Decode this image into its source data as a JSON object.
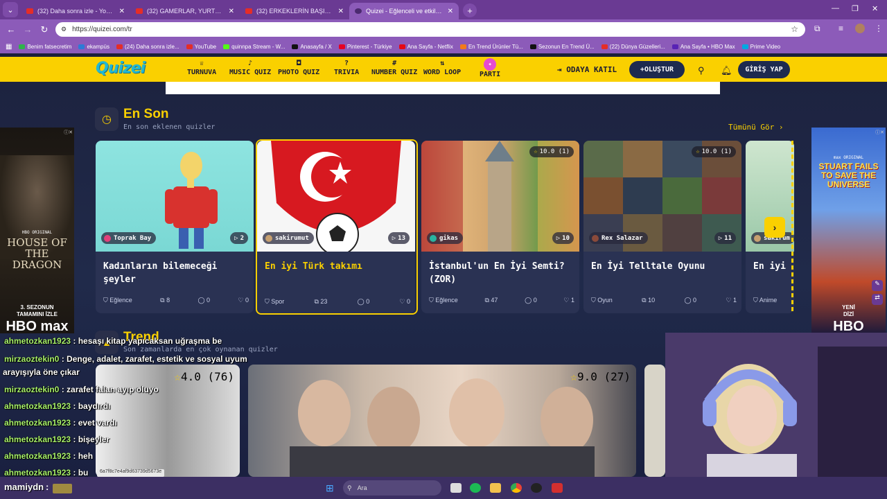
{
  "browser": {
    "tabs": [
      {
        "title": "(32) Daha sonra izle - YouTube",
        "icon": "youtube-icon"
      },
      {
        "title": "(32) GAMERLAR, YURTDIŞINDA",
        "icon": "youtube-icon"
      },
      {
        "title": "(32) ERKEKLERİN BAŞINI DÖNDÜ",
        "icon": "youtube-icon"
      },
      {
        "title": "Quizei - Eğlenceli ve etkileşimli",
        "icon": "quizei-icon"
      }
    ],
    "url": "https://quizei.com/tr",
    "bookmarks": [
      {
        "label": "Benim fatsecretim",
        "color": "#2fb34a"
      },
      {
        "label": "ekampüs",
        "color": "#2d7bd6"
      },
      {
        "label": "(24) Daha sonra izle...",
        "color": "#e52d27"
      },
      {
        "label": "YouTube",
        "color": "#e52d27"
      },
      {
        "label": "quinnpa Stream - W...",
        "color": "#53fc18"
      },
      {
        "label": "Anasayfa / X",
        "color": "#111111"
      },
      {
        "label": "Pinterest - Türkiye",
        "color": "#e60023"
      },
      {
        "label": "Ana Sayfa - Netflix",
        "color": "#e50914"
      },
      {
        "label": "En Trend Ürünler Tü...",
        "color": "#f27a1a"
      },
      {
        "label": "Sezonun En Trend Ü...",
        "color": "#111111"
      },
      {
        "label": "(22) Dünya Güzelleri...",
        "color": "#e52d27"
      },
      {
        "label": "Ana Sayfa • HBO Max",
        "color": "#5822b4"
      },
      {
        "label": "Prime Video",
        "color": "#00a8e1"
      }
    ]
  },
  "site": {
    "logo": "Quizei",
    "nav": [
      {
        "label": "TURNUVA",
        "icon": "trophy-icon"
      },
      {
        "label": "MUSIC QUIZ",
        "icon": "music-icon"
      },
      {
        "label": "PHOTO QUIZ",
        "icon": "camera-icon"
      },
      {
        "label": "TRIVIA",
        "icon": "question-icon"
      },
      {
        "label": "NUMBER QUIZ",
        "icon": "hash-icon"
      },
      {
        "label": "WORD LOOP",
        "icon": "sort-icon"
      },
      {
        "label": "PARTI",
        "icon": "party-icon"
      }
    ],
    "join_room": "ODAYA KATIL",
    "create": "OLUŞTUR",
    "login": "GİRİŞ YAP"
  },
  "latest": {
    "title": "En Son",
    "subtitle": "En son eklenen quizler",
    "see_all": "Tümünü Gör",
    "cards": [
      {
        "title": "Kadınların bilemeceği şeyler",
        "author": "Toprak Bay",
        "plays": "2",
        "category": "Eğlence",
        "questions": "8",
        "comments": "0",
        "likes": "0",
        "rating": ""
      },
      {
        "title": "En iyi Türk takımı",
        "author": "sakirumut",
        "plays": "13",
        "category": "Spor",
        "questions": "23",
        "comments": "0",
        "likes": "0",
        "rating": ""
      },
      {
        "title": "İstanbul'un En İyi Semti? (ZOR)",
        "author": "gikas",
        "plays": "10",
        "category": "Eğlence",
        "questions": "47",
        "comments": "0",
        "likes": "1",
        "rating": "10.0 (1)"
      },
      {
        "title": "En İyi Telltale Oyunu",
        "author": "Rex Salazar",
        "plays": "11",
        "category": "Oyun",
        "questions": "10",
        "comments": "0",
        "likes": "1",
        "rating": "10.0 (1)"
      },
      {
        "title": "En iyi",
        "author": "sakirum",
        "plays": "",
        "category": "Anime",
        "questions": "",
        "comments": "",
        "likes": "",
        "rating": ""
      }
    ]
  },
  "trend": {
    "title": "Trend",
    "subtitle": "Son zamanlarda en çok oynanan quizler",
    "cards": [
      {
        "rating": "4.0 (76)"
      },
      {
        "rating": "9.0 (27)"
      }
    ]
  },
  "ads": {
    "left": {
      "badge": "HBO ORIGINAL",
      "title": "HOUSE OF THE DRAGON",
      "line1": "3. SEZONUN",
      "line2": "TAMAMINI İZLE",
      "brand": "HBO max"
    },
    "right": {
      "badge": "max ORIGINAL",
      "title": "STUART FAILS TO SAVE THE UNIVERSE",
      "line1": "YENİ",
      "line2": "DİZİ",
      "brand": "HBO"
    }
  },
  "chat": [
    {
      "user": "ahmetozkan1923",
      "msg": "hesaşı kitap yapıcaksan uğraşma be"
    },
    {
      "user": "mirzaoztekin0",
      "msg": "Denge, adalet, zarafet, estetik ve sosyal uyum"
    },
    {
      "user": "",
      "msg": "arayışıyla öne çıkar"
    },
    {
      "user": "mirzaoztekin0",
      "msg": "zarafet falan ayıp oluyo"
    },
    {
      "user": "ahmetozkan1923",
      "msg": "baydırdı"
    },
    {
      "user": "ahmetozkan1923",
      "msg": "evet vardı"
    },
    {
      "user": "ahmetozkan1923",
      "msg": "bişeyler"
    },
    {
      "user": "ahmetozkan1923",
      "msg": "heh"
    },
    {
      "user": "ahmetozkan1923",
      "msg": "bu"
    },
    {
      "user": "mamiydn",
      "msg": ""
    }
  ],
  "status_url": "6a7f8c7e4af9d63739d5673e",
  "taskbar": {
    "search": "Ara"
  },
  "colors": {
    "accent": "#fad000",
    "browser": "#8c5bb9",
    "bg": "#1d2340"
  }
}
